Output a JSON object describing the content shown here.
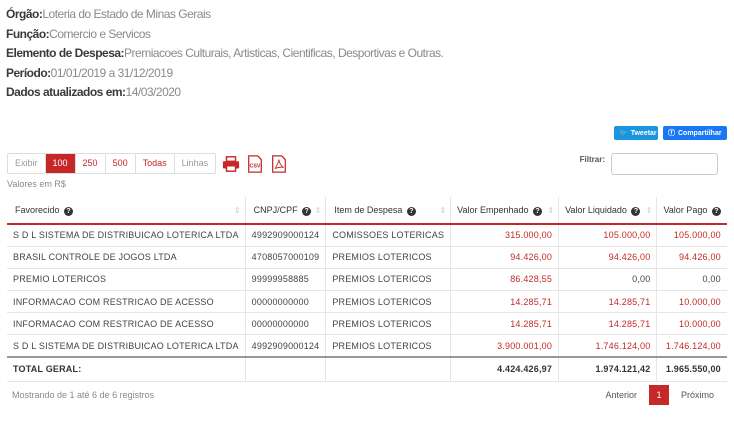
{
  "meta": [
    {
      "label": "Órgão:",
      "value": "Loteria do Estado de Minas Gerais"
    },
    {
      "label": "Função:",
      "value": "Comercio e Servicos"
    },
    {
      "label": "Elemento de Despesa:",
      "value": "Premiacoes Culturais, Artisticas, Cientificas, Desportivas e Outras."
    },
    {
      "label": "Período:",
      "value": "01/01/2019 a 31/12/2019"
    },
    {
      "label": "Dados atualizados em:",
      "value": "14/03/2020"
    }
  ],
  "social": {
    "tweet": "Tweetar",
    "share": "Compartilhar"
  },
  "page_length": {
    "exibir": "Exibir",
    "options": [
      "100",
      "250",
      "500",
      "Todas"
    ],
    "selected": "100",
    "linhas": "Linhas"
  },
  "export_icons": [
    "print-icon",
    "csv-icon",
    "pdf-icon"
  ],
  "export": {
    "csv_text": "CSV"
  },
  "filter": {
    "label": "Filtrar:",
    "value": ""
  },
  "caption": "Valores em R$",
  "table": {
    "headers": [
      "Favorecido",
      "CNPJ/CPF",
      "Item de Despesa",
      "Valor Empenhado",
      "Valor Liquidado",
      "Valor Pago"
    ],
    "rows": [
      [
        "S D L SISTEMA DE DISTRIBUICAO LOTERICA LTDA",
        "4992909000124",
        "COMISSOES LOTERICAS",
        "315.000,00",
        "105.000,00",
        "105.000,00"
      ],
      [
        "BRASIL CONTROLE DE JOGOS LTDA",
        "4708057000109",
        "PREMIOS LOTERICOS",
        "94.426,00",
        "94.426,00",
        "94.426,00"
      ],
      [
        "PREMIO LOTERICOS",
        "99999958885",
        "PREMIOS LOTERICOS",
        "86.428,55",
        "0,00",
        "0,00"
      ],
      [
        "INFORMACAO COM RESTRICAO DE ACESSO",
        "00000000000",
        "PREMIOS LOTERICOS",
        "14.285,71",
        "14.285,71",
        "10.000,00"
      ],
      [
        "INFORMACAO COM RESTRICAO DE ACESSO",
        "00000000000",
        "PREMIOS LOTERICOS",
        "14.285,71",
        "14.285,71",
        "10.000,00"
      ],
      [
        "S D L SISTEMA DE DISTRIBUICAO LOTERICA LTDA",
        "4992909000124",
        "PREMIOS LOTERICOS",
        "3.900.001,00",
        "1.746.124,00",
        "1.746.124,00"
      ]
    ],
    "total": {
      "label": "TOTAL GERAL:",
      "empenhado": "4.424.426,97",
      "liquidado": "1.974.121,42",
      "pago": "1.965.550,00"
    }
  },
  "footer": {
    "info": "Mostrando de 1 até 6 de 6 registros",
    "previous": "Anterior",
    "current_page": "1",
    "next": "Próximo"
  },
  "colors": {
    "accent": "#c62828",
    "twitter": "#1b95e0",
    "facebook": "#1877f2"
  }
}
